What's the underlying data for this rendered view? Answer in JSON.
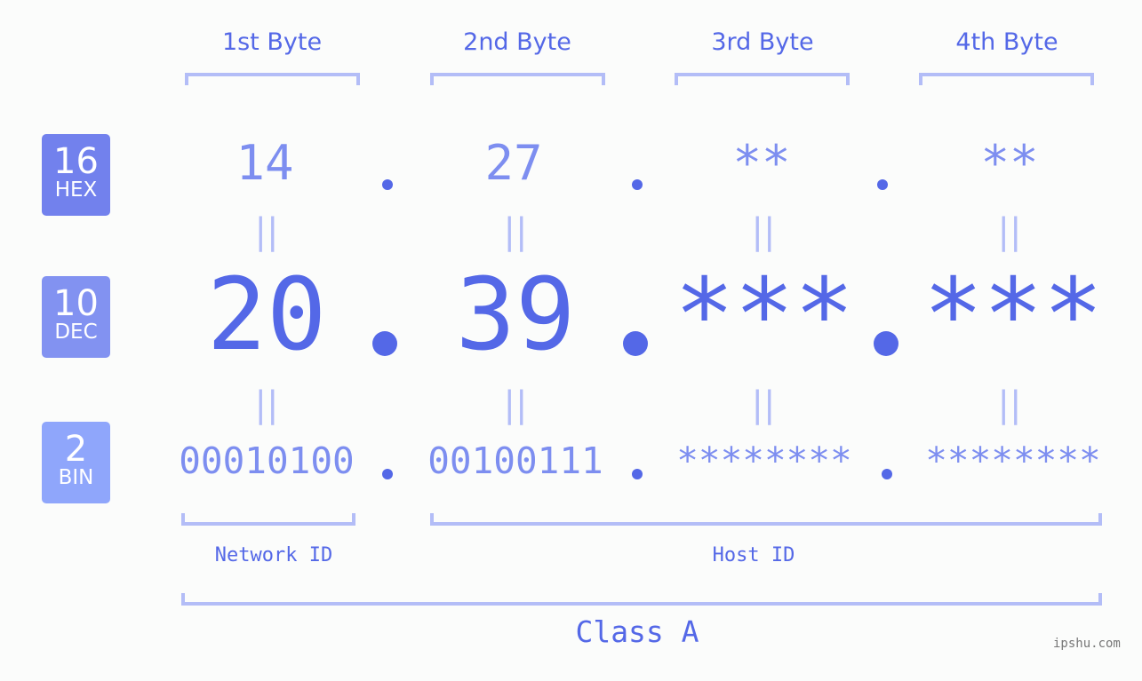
{
  "byte_headers": [
    "1st Byte",
    "2nd Byte",
    "3rd Byte",
    "4th Byte"
  ],
  "badges": [
    {
      "num": "16",
      "label": "HEX",
      "color": "#7281ed"
    },
    {
      "num": "10",
      "label": "DEC",
      "color": "#8292f1"
    },
    {
      "num": "2",
      "label": "BIN",
      "color": "#8fa6fb"
    }
  ],
  "hex": [
    "14",
    "27",
    "**",
    "**"
  ],
  "dec": [
    "20",
    "39",
    "***",
    "***"
  ],
  "bin": [
    "00010100",
    "00100111",
    "********",
    "********"
  ],
  "equals_glyph": "||",
  "network_id_label": "Network ID",
  "host_id_label": "Host ID",
  "class_label": "Class A",
  "watermark": "ipshu.com",
  "colors": {
    "accent": "#5468e7",
    "light": "#7d8ef0",
    "bracket": "#b3bdf7",
    "background": "#fbfcfb"
  }
}
